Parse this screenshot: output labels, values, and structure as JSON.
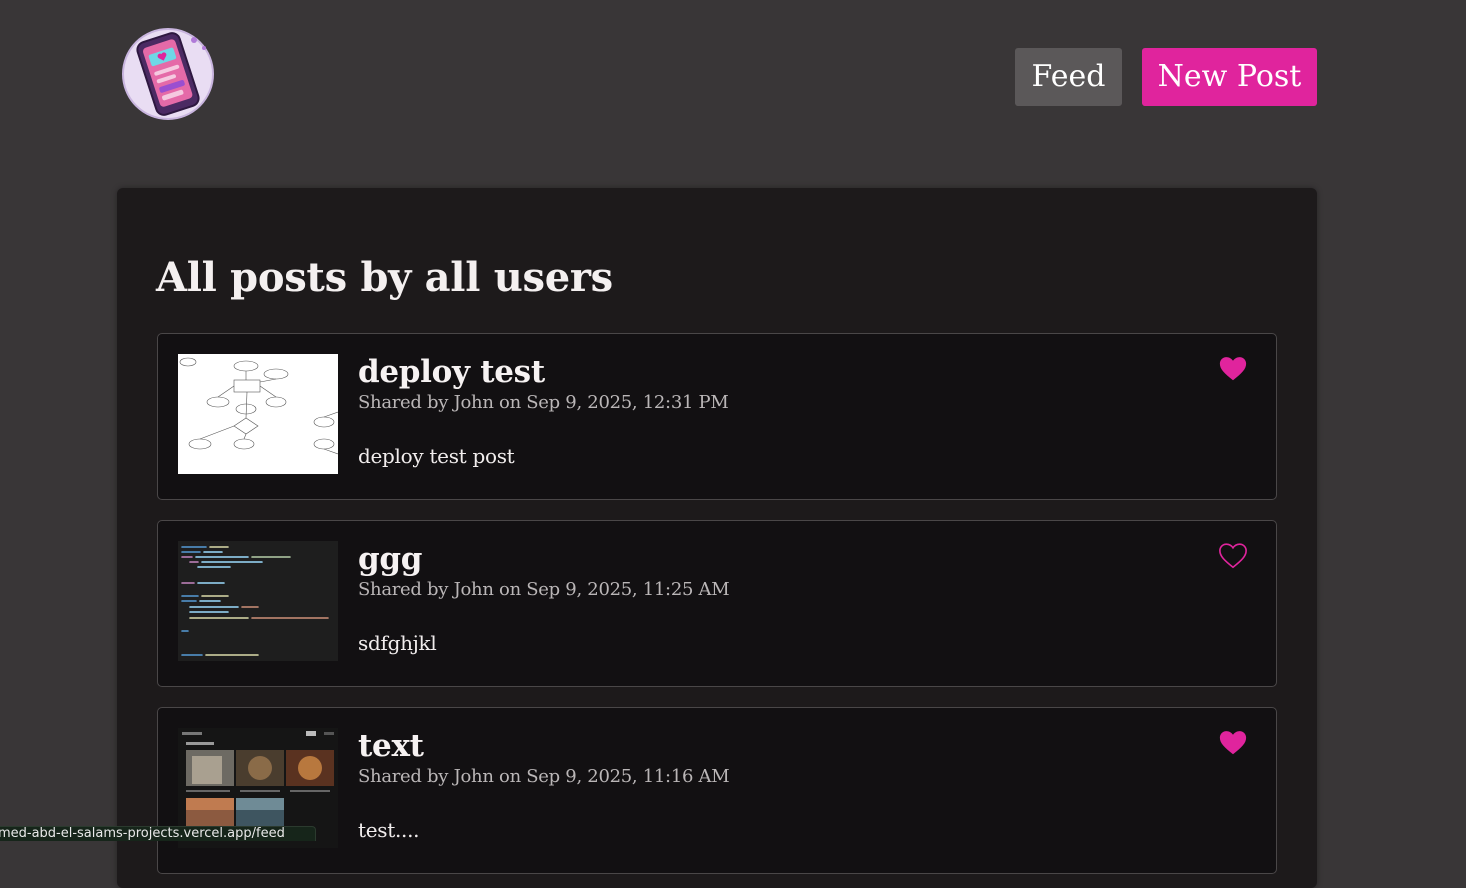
{
  "header": {
    "logo_icon": "phone-heart-logo",
    "nav": {
      "feed_label": "Feed",
      "new_post_label": "New Post"
    }
  },
  "colors": {
    "accent": "#e0249d",
    "background": "#393637",
    "panel": "#1d1a1b",
    "card": "#121012"
  },
  "main": {
    "title": "All posts by all users",
    "posts": [
      {
        "title": "deploy test",
        "meta": "Shared by John on Sep 9, 2025, 12:31 PM",
        "body": "deploy test post",
        "liked": true,
        "thumb": "er-diagram-image"
      },
      {
        "title": "ggg",
        "meta": "Shared by John on Sep 9, 2025, 11:25 AM",
        "body": "sdfghjkl",
        "liked": false,
        "thumb": "code-screenshot-image"
      },
      {
        "title": "text",
        "meta": "Shared by John on Sep 9, 2025, 11:16 AM",
        "body": "test....",
        "liked": true,
        "thumb": "gallery-screenshot-image"
      }
    ]
  },
  "status_bar": {
    "url": "amed-abd-el-salams-projects.vercel.app/feed"
  }
}
